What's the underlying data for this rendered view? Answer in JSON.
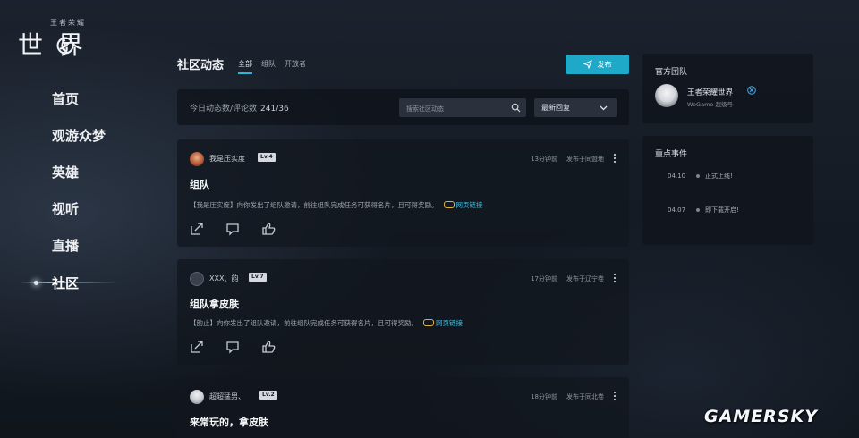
{
  "logo": {
    "sub": "王者荣耀",
    "main": "世 界"
  },
  "nav": {
    "items": [
      {
        "label": "首页"
      },
      {
        "label": "观游众梦"
      },
      {
        "label": "英雄"
      },
      {
        "label": "视听"
      },
      {
        "label": "直播"
      }
    ],
    "active_label": "社区"
  },
  "header": {
    "title": "社区动态",
    "tabs": [
      "全部",
      "组队",
      "开放者"
    ],
    "post_button": "发布"
  },
  "filter": {
    "stats_label": "今日动态数/评论数",
    "stats_value": "241/36",
    "search_placeholder": "搜索社区动态",
    "sort_label": "最新回复"
  },
  "posts": [
    {
      "author": "我是压实度",
      "level": "Lv.4",
      "time": "13分钟前",
      "source": "发布于同盟地",
      "title": "组队",
      "body": "【我是压实度】向你发出了组队邀请，前往组队完成任务可获得名片，且可得奖励。",
      "link": "网页链接"
    },
    {
      "author": "XXX、韵",
      "level": "Lv.7",
      "time": "17分钟前",
      "source": "发布于辽宁卷",
      "title": "组队拿皮肤",
      "body": "【韵止】向你发出了组队邀请，前往组队完成任务可获得名片，且可得奖励。",
      "link": "网页链接"
    },
    {
      "author": "超超猛男、",
      "level": "Lv.2",
      "time": "18分钟前",
      "source": "发布于同北卷",
      "title": "来常玩的，拿皮肤"
    }
  ],
  "official": {
    "title": "官方团队",
    "name": "王者荣耀世界",
    "desc": "WeGame 超级号"
  },
  "events": {
    "title": "重点事件",
    "items": [
      {
        "date": "04.10",
        "text": "正式上线!"
      },
      {
        "date": "04.07",
        "text": "即下载开启!"
      }
    ]
  },
  "watermark": "GAMERSKY",
  "colors": {
    "accent": "#1fa9c9",
    "link": "#3cc0e0",
    "background": "#161c25"
  },
  "icons": [
    "logo-swirl-icon",
    "paper-plane-icon",
    "search-icon",
    "chevron-down-icon",
    "more-vertical-icon",
    "share-icon",
    "comment-icon",
    "like-icon",
    "verified-icon"
  ]
}
